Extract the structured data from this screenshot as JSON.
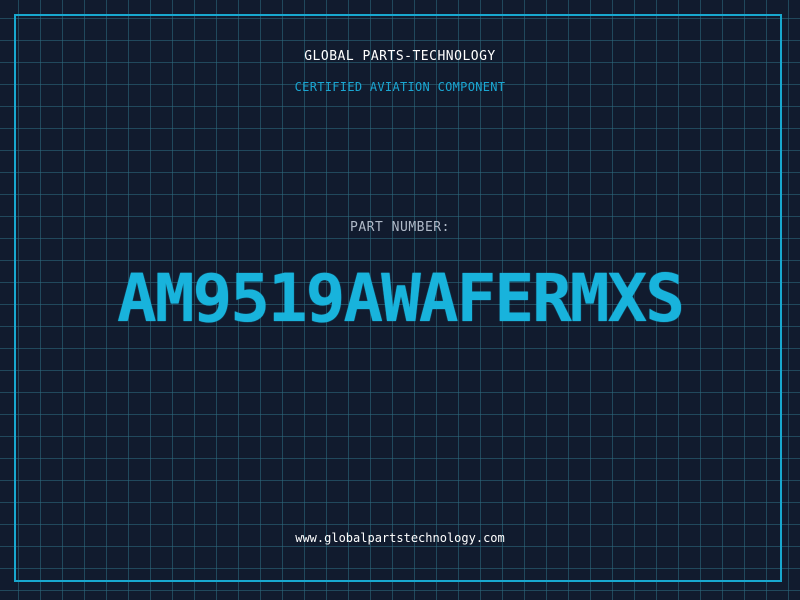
{
  "header": {
    "company": "GLOBAL PARTS-TECHNOLOGY",
    "subtitle": "CERTIFIED AVIATION COMPONENT"
  },
  "part": {
    "label": "PART NUMBER:",
    "number": "AM9519AWAFERMXS"
  },
  "footer": {
    "url": "www.globalpartstechnology.com"
  },
  "colors": {
    "background": "#111b2e",
    "grid": "#2d6e82",
    "accent": "#18b3dc",
    "text": "#ffffff"
  }
}
